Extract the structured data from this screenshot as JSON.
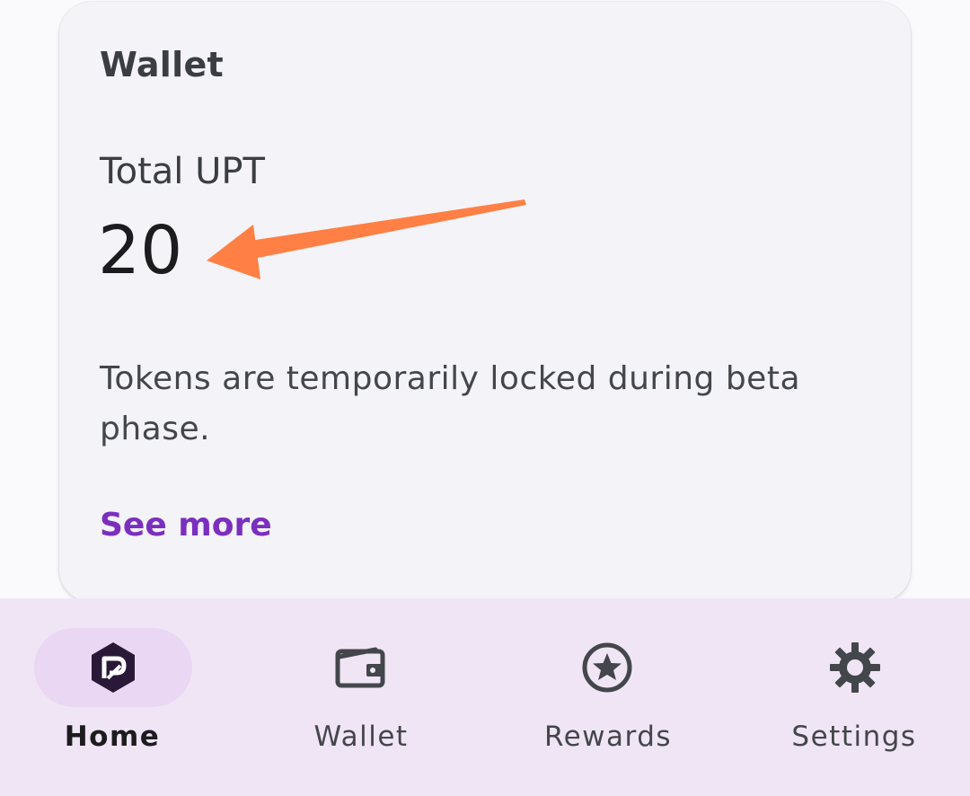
{
  "wallet_card": {
    "title": "Wallet",
    "total_label": "Total UPT",
    "total_value": "20",
    "notice": "Tokens are temporarily locked during beta phase.",
    "see_more": "See more"
  },
  "annotation": {
    "arrow_color": "#ff7f45",
    "points_to": "total-value"
  },
  "bottom_nav": {
    "items": [
      {
        "label": "Home",
        "icon": "app-logo-icon",
        "active": true
      },
      {
        "label": "Wallet",
        "icon": "wallet-icon",
        "active": false
      },
      {
        "label": "Rewards",
        "icon": "star-circle-icon",
        "active": false
      },
      {
        "label": "Settings",
        "icon": "gear-icon",
        "active": false
      }
    ],
    "active_indicator_color": "#ead7f3",
    "background_color": "#f0e5f5"
  },
  "colors": {
    "accent": "#7b2fbe",
    "card_background": "#f4f3f7"
  }
}
